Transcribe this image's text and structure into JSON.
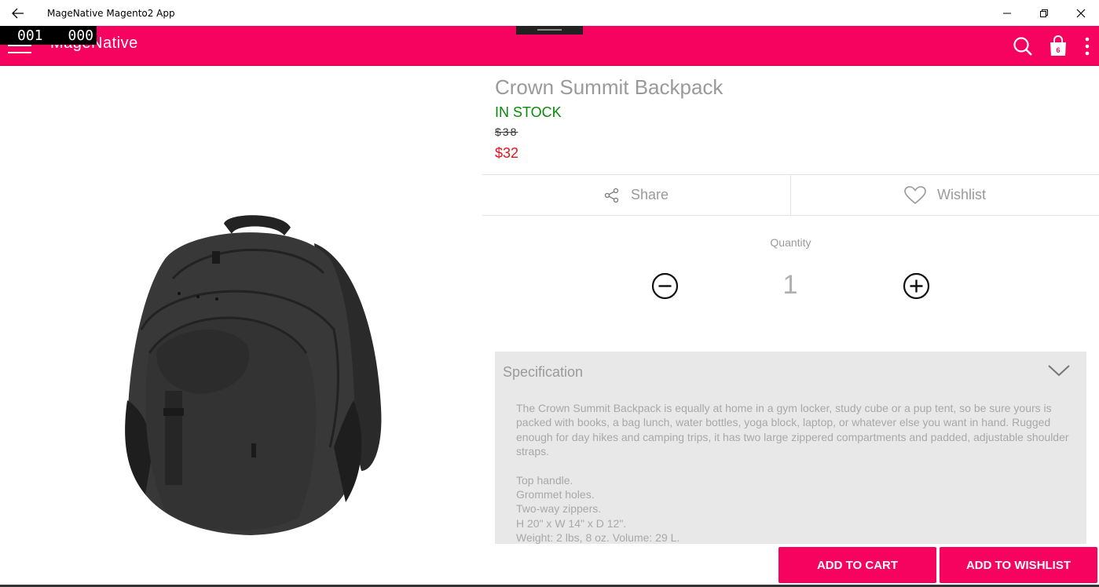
{
  "window": {
    "title": "MageNative Magento2 App"
  },
  "appbar": {
    "brand": "MageNative",
    "cart_count": "6",
    "accent": "#f5035f"
  },
  "counter": {
    "left": "001",
    "right": "000"
  },
  "product": {
    "title": "Crown Summit Backpack",
    "stock": "IN STOCK",
    "old_price": "$38",
    "new_price": "$32"
  },
  "actions": {
    "share": "Share",
    "wishlist": "Wishlist"
  },
  "quantity": {
    "label": "Quantity",
    "value": "1"
  },
  "specification": {
    "title": "Specification",
    "description": "The Crown Summit Backpack is equally at home in a gym locker, study cube or a pup tent, so be sure yours is packed with books, a bag lunch, water bottles, yoga block, laptop, or whatever else you want in hand. Rugged enough for day hikes and camping trips, it has two large zippered compartments and padded, adjustable shoulder straps.",
    "features": [
      "Top handle.",
      "Grommet holes.",
      "Two-way zippers.",
      "H 20\" x W 14\" x D 12\".",
      "Weight: 2 lbs, 8 oz. Volume: 29 L."
    ]
  },
  "buttons": {
    "add_to_cart": "ADD TO CART",
    "add_to_wishlist": "ADD TO WISHLIST"
  }
}
